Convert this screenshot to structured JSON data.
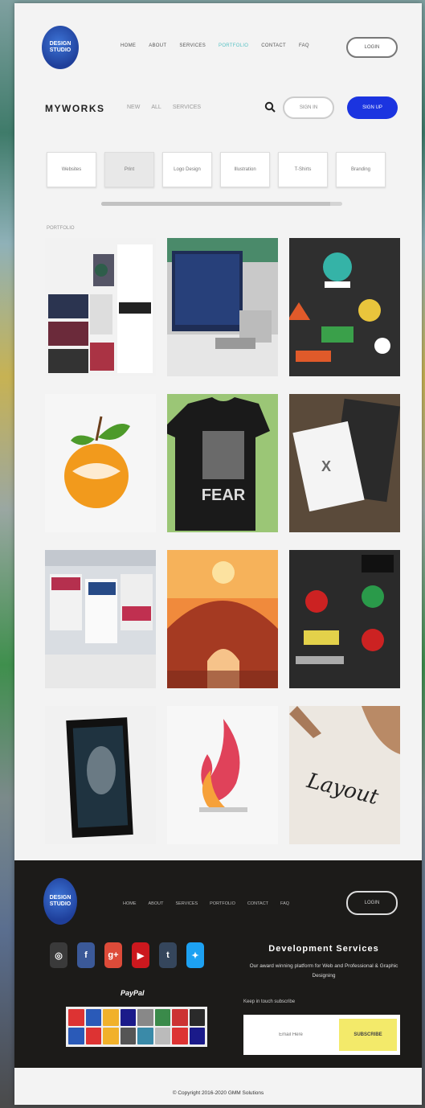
{
  "nav": {
    "logo_text": "DESIGN STUDIO",
    "links": [
      "HOME",
      "ABOUT",
      "SERVICES",
      "PORTFOLIO",
      "CONTACT",
      "FAQ"
    ],
    "active_index": 3,
    "login_label": "LOGIN"
  },
  "titlebar": {
    "brand": "MYWORKS",
    "subnav": [
      "NEW",
      "ALL",
      "SERVICES"
    ],
    "signin_label": "SIGN IN",
    "signup_label": "SIGN UP"
  },
  "tabs": [
    "Websites",
    "Print",
    "Logo Design",
    "Illustration",
    "T-Shirts",
    "Branding"
  ],
  "active_tab": 1,
  "tabs_scroll_fraction": 0.95,
  "section_label": "PORTFOLIO",
  "portfolio": [
    {
      "name": "web-layout-collage"
    },
    {
      "name": "desktop-workspace"
    },
    {
      "name": "logo-collection-dark"
    },
    {
      "name": "orange-fruit-logo"
    },
    {
      "name": "fear-tshirt"
    },
    {
      "name": "stationery-mockup"
    },
    {
      "name": "exhibition-stands"
    },
    {
      "name": "bridge-illustration"
    },
    {
      "name": "dark-logo-set"
    },
    {
      "name": "book-cover"
    },
    {
      "name": "flame-logo"
    },
    {
      "name": "layout-lettering"
    }
  ],
  "footer": {
    "links": [
      "HOME",
      "ABOUT",
      "SERVICES",
      "PORTFOLIO",
      "CONTACT",
      "FAQ"
    ],
    "login_label": "LOGIN",
    "socials": [
      {
        "icon": "instagram-icon",
        "color": "#3a3a3a",
        "glyph": "◎"
      },
      {
        "icon": "facebook-icon",
        "color": "#3b5998",
        "glyph": "f"
      },
      {
        "icon": "google-plus-icon",
        "color": "#dd4b39",
        "glyph": "g+"
      },
      {
        "icon": "youtube-icon",
        "color": "#cc181e",
        "glyph": "▶"
      },
      {
        "icon": "tumblr-icon",
        "color": "#35465c",
        "glyph": "t"
      },
      {
        "icon": "twitter-icon",
        "color": "#1da1f2",
        "glyph": "✦"
      }
    ],
    "paypal": "PayPal",
    "dev_title": "Development Services",
    "dev_text": "Our award winning platform for Web and Professional & Graphic Designing",
    "dev_note": "Keep in touch subscribe",
    "email_placeholder": "Email Here",
    "subscribe_label": "SUBSCRIBE"
  },
  "copyright": "© Copyright 2016-2020 GMM Solutions"
}
